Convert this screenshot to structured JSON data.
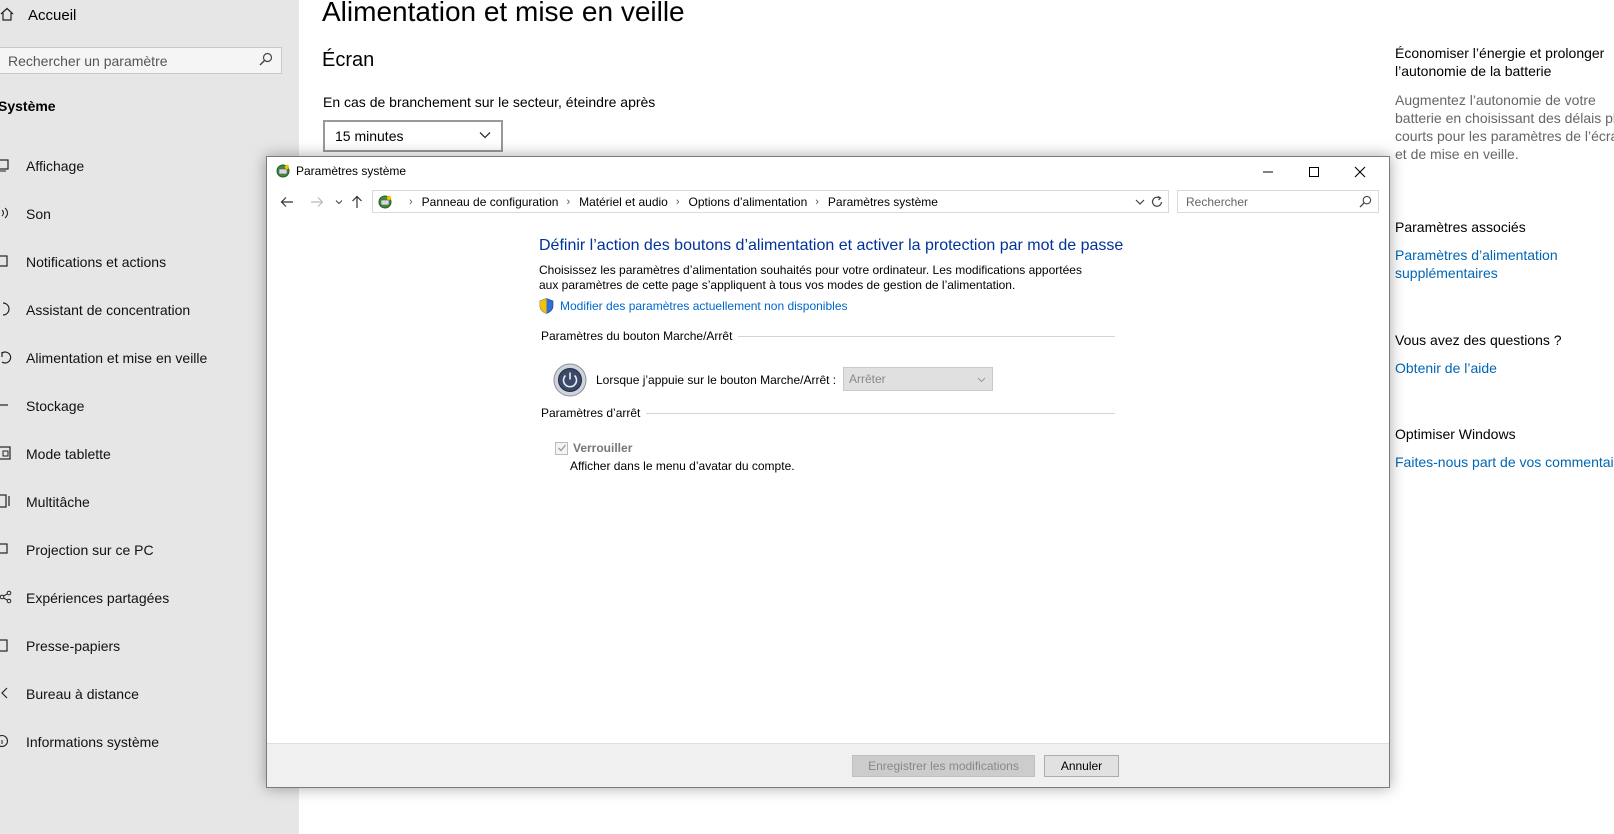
{
  "settings": {
    "home_label": "Accueil",
    "search_placeholder": "Rechercher un paramètre",
    "group_title": "Système",
    "nav": [
      {
        "label": "Affichage",
        "icon": "display-icon"
      },
      {
        "label": "Son",
        "icon": "speaker-icon"
      },
      {
        "label": "Notifications et actions",
        "icon": "notification-icon"
      },
      {
        "label": "Assistant de concentration",
        "icon": "moon-icon"
      },
      {
        "label": "Alimentation et mise en veille",
        "icon": "power-icon"
      },
      {
        "label": "Stockage",
        "icon": "storage-icon"
      },
      {
        "label": "Mode tablette",
        "icon": "tablet-icon"
      },
      {
        "label": "Multitâche",
        "icon": "multitask-icon"
      },
      {
        "label": "Projection sur ce PC",
        "icon": "projection-icon"
      },
      {
        "label": "Expériences partagées",
        "icon": "share-icon"
      },
      {
        "label": "Presse-papiers",
        "icon": "clipboard-icon"
      },
      {
        "label": "Bureau à distance",
        "icon": "remote-icon"
      },
      {
        "label": "Informations système",
        "icon": "info-icon"
      }
    ],
    "main": {
      "title": "Alimentation et mise en veille",
      "section": "Écran",
      "field_label": "En cas de branchement sur le secteur, éteindre après",
      "field_value": "15 minutes"
    },
    "right_panel": {
      "heading1_line1": "Économiser l’énergie et prolonger",
      "heading1_line2": "l’autonomie de la batterie",
      "text_line1": "Augmentez l’autonomie de votre",
      "text_line2": "batterie en choisissant des délais plus",
      "text_line3": "courts pour les paramètres de l’écran",
      "text_line4": "et de mise en veille.",
      "related_heading": "Paramètres associés",
      "related_link_line1": "Paramètres d’alimentation",
      "related_link_line2": "supplémentaires",
      "questions_heading": "Vous avez des questions ?",
      "help_link": "Obtenir de l’aide",
      "optimize_heading": "Optimiser Windows",
      "feedback_link": "Faites-nous part de vos commentaires"
    }
  },
  "dialog": {
    "title": "Paramètres système",
    "breadcrumbs": [
      "Panneau de configuration",
      "Matériel et audio",
      "Options d’alimentation",
      "Paramètres système"
    ],
    "search_placeholder": "Rechercher",
    "heading": "Définir l’action des boutons d’alimentation et activer la protection par mot de passe",
    "description": "Choisissez les paramètres d’alimentation souhaités pour votre ordinateur. Les modifications apportées aux paramètres de cette page s’appliquent à tous vos modes de gestion de l’alimentation.",
    "change_unavailable_link": "Modifier des paramètres actuellement non disponibles",
    "power_button_group": "Paramètres du bouton Marche/Arrêt",
    "power_button_label": "Lorsque j’appuie sur le bouton Marche/Arrêt :",
    "power_button_value": "Arrêter",
    "shutdown_group": "Paramètres d’arrêt",
    "lock_label": "Verrouiller",
    "lock_sub": "Afficher dans le menu d’avatar du compte.",
    "save_button": "Enregistrer les modifications",
    "cancel_button": "Annuler"
  },
  "colors": {
    "link": "#0066cc",
    "heading": "#003399",
    "sidebar_bg": "#e6e6e6"
  }
}
